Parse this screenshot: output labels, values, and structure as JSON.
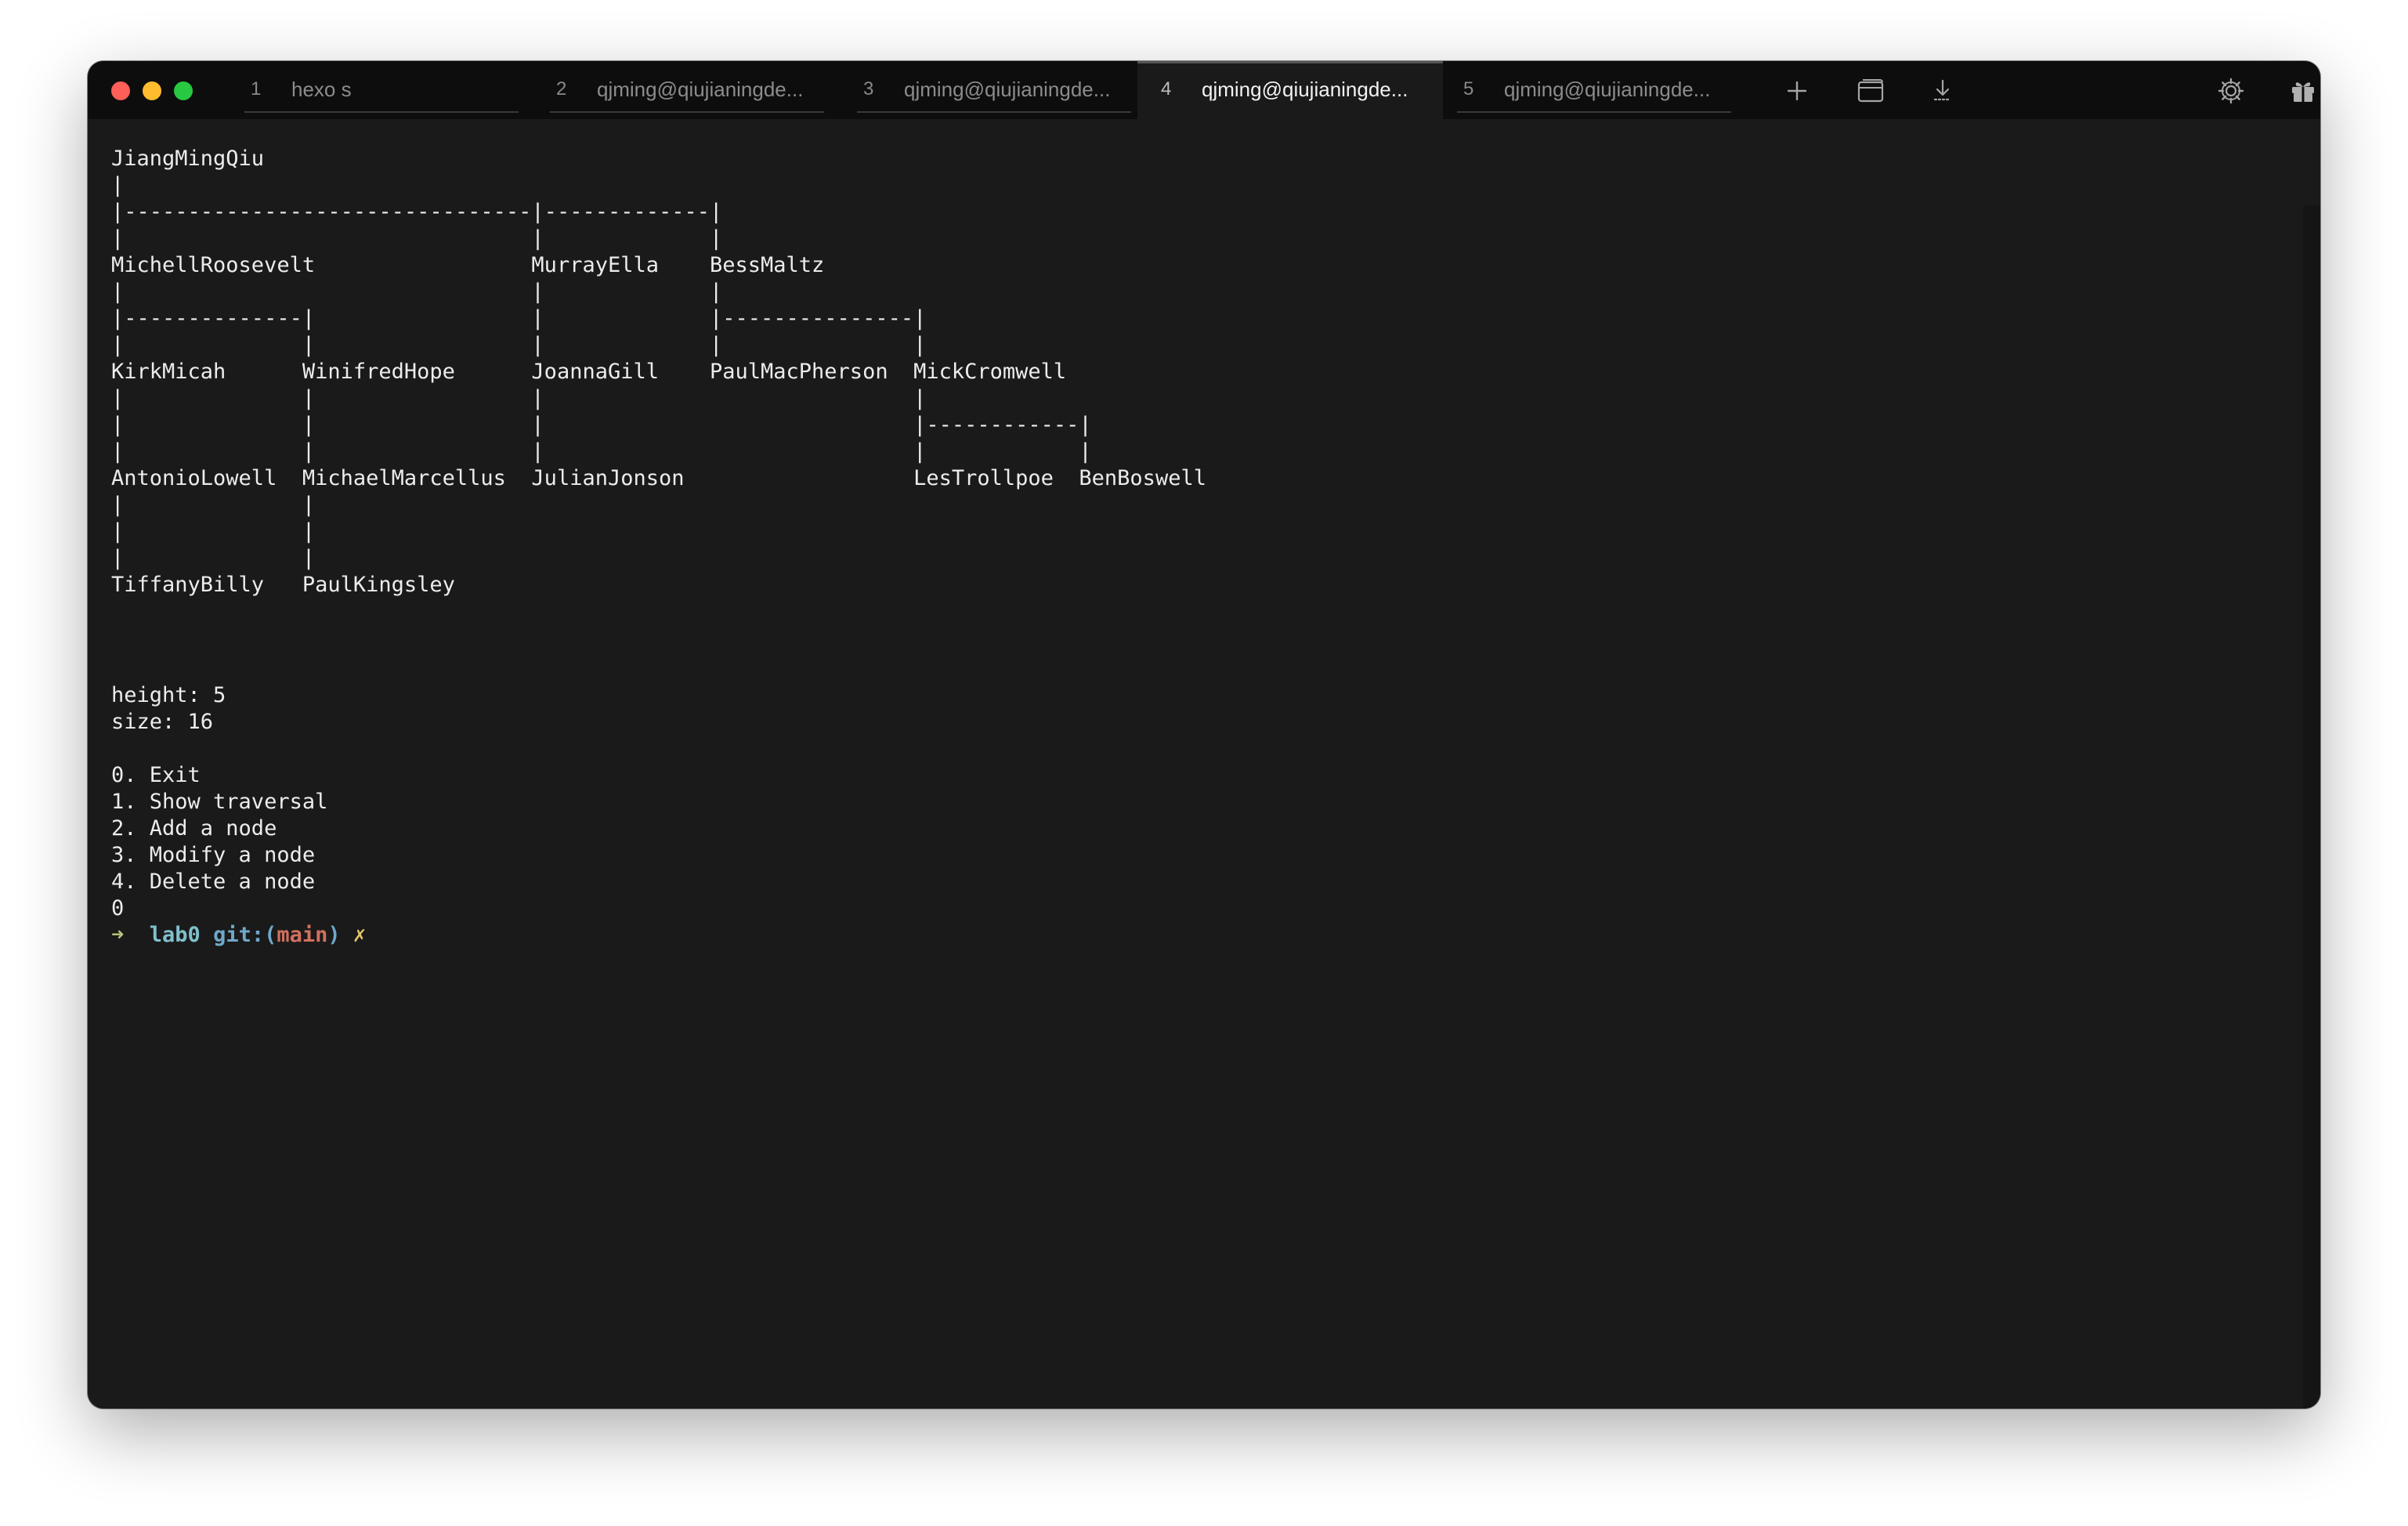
{
  "tabs": [
    {
      "num": "1",
      "title": "hexo s",
      "active": false
    },
    {
      "num": "2",
      "title": "qjming@qiujianingde...",
      "active": false
    },
    {
      "num": "3",
      "title": "qjming@qiujianingde...",
      "active": false
    },
    {
      "num": "4",
      "title": "qjming@qiujianingde...",
      "active": true
    },
    {
      "num": "5",
      "title": "qjming@qiujianingde...",
      "active": false
    }
  ],
  "toolbar": {
    "new_tab_icon": "plus-icon",
    "split_icon": "split-pane-icon",
    "download_icon": "download-icon",
    "settings_icon": "gear-icon",
    "gift_icon": "gift-icon"
  },
  "terminal": {
    "tree": "JiangMingQiu\n|\n|--------------------------------|-------------|\n|                                |             |\nMichellRoosevelt                 MurrayElla    BessMaltz\n|                                |             |\n|--------------|                 |             |---------------|\n|              |                 |             |               |\nKirkMicah      WinifredHope      JoannaGill    PaulMacPherson  MickCromwell\n|              |                 |                             |\n|              |                 |                             |------------|\n|              |                 |                             |            |\nAntonioLowell  MichaelMarcellus  JulianJonson                  LesTrollpoe  BenBoswell\n|              |\n|              |\n|              |\nTiffanyBilly   PaulKingsley",
    "height_line": "height: 5",
    "size_line": "size: 16",
    "menu": [
      "0. Exit",
      "1. Show traversal",
      "2. Add a node",
      "3. Modify a node",
      "4. Delete a node"
    ],
    "input": "0",
    "prompt": {
      "arrow": "➜",
      "dir": "lab0",
      "git_prefix": "git:(",
      "branch": "main",
      "git_suffix": ")",
      "dirty": "✗"
    }
  },
  "colors": {
    "window_bg": "#1a1a1a",
    "titlebar_bg": "#0d0d0d",
    "text": "#ececec",
    "prompt_arrow": "#b8c27a",
    "prompt_dir": "#7fc1cc",
    "prompt_branch": "#d2705f",
    "prompt_dirty": "#e5c46a"
  }
}
